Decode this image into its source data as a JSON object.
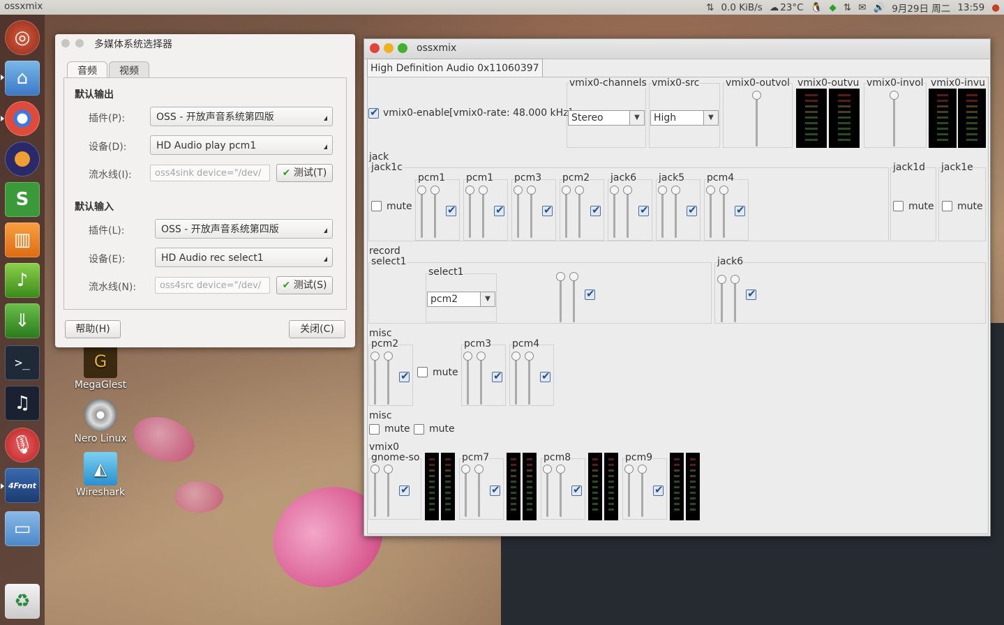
{
  "topbar": {
    "app_title": "ossxmix",
    "net_speed": "0.0 KiB/s",
    "weather": "23°C",
    "date": "9月29日 周二",
    "time": "13:59"
  },
  "launcher": {
    "items": [
      "ubuntu-home-icon",
      "files-icon",
      "chrome-icon",
      "eclipse-icon",
      "spreadsheet-icon",
      "software-center-icon",
      "music-player-icon",
      "download-icon",
      "terminal-icon",
      "audio-player-icon",
      "sound-recorder-icon",
      "4front-icon",
      "workspace-icon",
      "trash-icon"
    ]
  },
  "desktop": {
    "icons": [
      {
        "label": "MegaGlest",
        "icon": "megaglest-icon"
      },
      {
        "label": "Nero Linux",
        "icon": "disc-icon"
      },
      {
        "label": "Wireshark",
        "icon": "shark-fin-icon"
      }
    ]
  },
  "dialog": {
    "title": "多媒体系统选择器",
    "tabs": [
      "音频",
      "视频"
    ],
    "output": {
      "heading": "默认输出",
      "plugin_label": "插件(P):",
      "plugin_value": "OSS - 开放声音系统第四版",
      "device_label": "设备(D):",
      "device_value": "HD Audio play pcm1",
      "pipeline_label": "流水线(I):",
      "pipeline_value": "oss4sink device=\"/dev/",
      "test_button": "测试(T)"
    },
    "input": {
      "heading": "默认输入",
      "plugin_label": "插件(L):",
      "plugin_value": "OSS - 开放声音系统第四版",
      "device_label": "设备(E):",
      "device_value": "HD Audio rec select1",
      "pipeline_label": "流水线(N):",
      "pipeline_value": "oss4src device=\"/dev/",
      "test_button": "测试(S)"
    },
    "help_button": "帮助(H)",
    "close_button": "关闭(C)"
  },
  "ossxmix": {
    "title": "ossxmix",
    "device_tab": "High Definition Audio 0x11060397",
    "vmix": {
      "enable_label": "vmix0-enable",
      "rate_label": "[vmix0-rate: 48.000 kHz]",
      "channels_label": "vmix0-channels",
      "channels_value": "Stereo",
      "src_label": "vmix0-src",
      "src_value": "High",
      "outvol_label": "vmix0-outvol",
      "outvu_label": "vmix0-outvu",
      "invol_label": "vmix0-invol",
      "invu_label": "vmix0-invu"
    },
    "jack": {
      "heading": "jack",
      "group_label": "jack1c",
      "mute_label": "mute",
      "channels": [
        "pcm1",
        "pcm1",
        "pcm3",
        "pcm2",
        "jack6",
        "jack5",
        "pcm4"
      ],
      "jack1d_label": "jack1d",
      "jack1e_label": "jack1e"
    },
    "record": {
      "heading": "record",
      "group_label": "select1",
      "select_label": "select1",
      "select_value": "pcm2",
      "jack6_label": "jack6"
    },
    "misc1": {
      "heading": "misc",
      "pcm2_label": "pcm2",
      "mute_label": "mute",
      "pcm3_label": "pcm3",
      "pcm4_label": "pcm4"
    },
    "misc2": {
      "heading": "misc",
      "mute1_label": "mute",
      "mute2_label": "mute"
    },
    "vmix0": {
      "heading": "vmix0",
      "channels": [
        "gnome-so",
        "pcm7",
        "pcm8",
        "pcm9"
      ]
    }
  }
}
